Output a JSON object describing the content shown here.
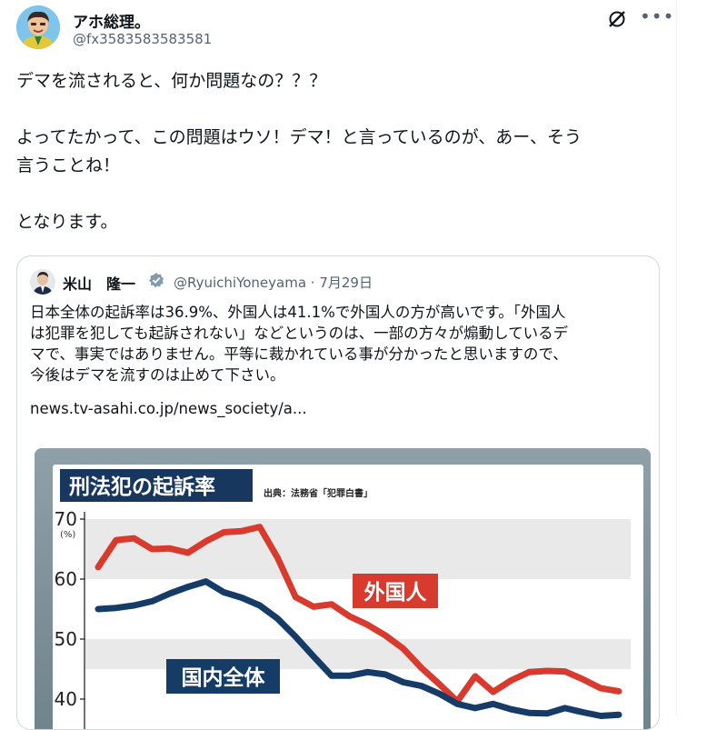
{
  "tweet": {
    "author_name": "アホ総理。",
    "author_handle": "@fx3583583583581",
    "lines": [
      "デマを流されると、何か問題なの？？？",
      "",
      "よってたかって、この問題はウソ！デマ！と言っているのが、あー、そう",
      "言うことね！",
      "",
      "となります。"
    ]
  },
  "quoted": {
    "author_name": "米山　隆一",
    "author_handle": "@RyuichiYoneyama · 7月29日",
    "text_lines": [
      "日本全体の起訴率は36.9%、外国人は41.1%で外国人の方が高いです。「外国人",
      "は犯罪を犯しても起訴されない」などというのは、一部の方々が煽動しているデ",
      "マで、事実ではありません。平等に裁かれている事が分かったと思いますので、",
      "今後はデマを流すのは止めて下さい。"
    ],
    "link": "news.tv-asahi.co.jp/news_society/a..."
  },
  "chart_data": {
    "type": "line",
    "title": "刑法犯の起訴率",
    "source_note": "出典：法務省「犯罪白書」",
    "y_unit": "(%)",
    "y_ticks": [
      "70",
      "60",
      "50",
      "40"
    ],
    "ylim": [
      40,
      70
    ],
    "grid": "horizontal bands",
    "series": [
      {
        "name": "外国人",
        "color": "#d93a2e",
        "values": [
          62,
          66.5,
          66.8,
          65,
          65.1,
          64.4,
          66.3,
          67.8,
          68,
          68.7,
          63.5,
          57,
          55.4,
          55.8,
          53.8,
          52.4,
          50.6,
          48.4,
          45.2,
          42.5,
          39.6,
          43.8,
          41.2,
          43.1,
          44.5,
          44.7,
          44.6,
          43.3,
          41.8,
          41.3
        ]
      },
      {
        "name": "国内全体",
        "color": "#153b67",
        "values": [
          55,
          55.2,
          55.6,
          56.3,
          57.6,
          58.7,
          59.6,
          57.8,
          56.9,
          55.6,
          53.4,
          50.4,
          47.1,
          43.9,
          43.9,
          44.5,
          44.1,
          42.8,
          42.2,
          40.9,
          39.2,
          38.5,
          39.2,
          38.3,
          37.7,
          37.6,
          38.5,
          37.8,
          37.2,
          37.4
        ]
      }
    ]
  },
  "colors": {
    "text": "#0f1419",
    "secondary": "#536471",
    "verified": "#829aab",
    "chart_bg": "#7a8d96",
    "title_bg": "#17375e"
  }
}
